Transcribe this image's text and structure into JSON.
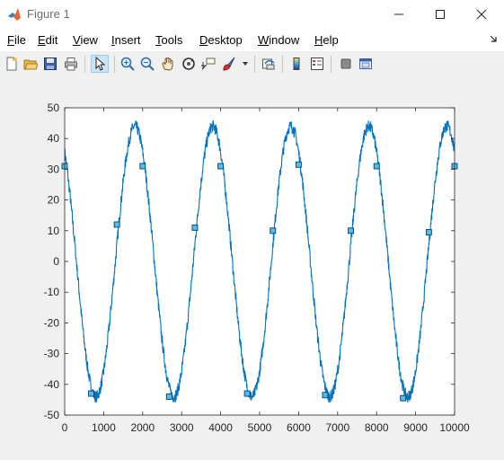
{
  "window": {
    "title": "Figure 1",
    "controls": [
      "minimize",
      "maximize",
      "close"
    ]
  },
  "menu": {
    "items": [
      {
        "label": "File",
        "accel": "F",
        "rest": "ile"
      },
      {
        "label": "Edit",
        "accel": "E",
        "rest": "dit"
      },
      {
        "label": "View",
        "accel": "V",
        "rest": "iew"
      },
      {
        "label": "Insert",
        "accel": "I",
        "rest": "nsert"
      },
      {
        "label": "Tools",
        "accel": "T",
        "rest": "ools"
      },
      {
        "label": "Desktop",
        "accel": "D",
        "rest": "esktop"
      },
      {
        "label": "Window",
        "accel": "W",
        "rest": "indow"
      },
      {
        "label": "Help",
        "accel": "H",
        "rest": "elp"
      }
    ]
  },
  "toolbar": {
    "buttons": [
      "new-figure-icon",
      "open-file-icon",
      "save-icon",
      "print-icon",
      "edit-plot-icon",
      "zoom-in-icon",
      "zoom-out-icon",
      "pan-icon",
      "rotate-3d-icon",
      "data-cursor-icon",
      "brush-icon",
      "link-plot-icon",
      "colorbar-icon",
      "legend-icon",
      "hide-plot-tools-icon",
      "show-plot-tools-icon"
    ]
  },
  "colors": {
    "series": "#0072bd",
    "marker_fill": "#4dbeee",
    "axes": "#262626"
  },
  "chart_data": {
    "type": "line",
    "xlim": [
      0,
      10000
    ],
    "ylim": [
      -50,
      50
    ],
    "xticks": [
      0,
      1000,
      2000,
      3000,
      4000,
      5000,
      6000,
      7000,
      8000,
      9000,
      10000
    ],
    "yticks": [
      -50,
      -40,
      -30,
      -20,
      -10,
      0,
      10,
      20,
      30,
      40,
      50
    ],
    "grid": false,
    "series": [
      {
        "style": "noisy sinusoid",
        "amplitude": 44,
        "period": 2000,
        "peak_x": 1800,
        "noise_band": 2,
        "x_range": [
          0,
          10000
        ]
      }
    ],
    "markers": [
      {
        "x": 0,
        "y": 31
      },
      {
        "x": 680,
        "y": -43
      },
      {
        "x": 1340,
        "y": 12
      },
      {
        "x": 2000,
        "y": 31
      },
      {
        "x": 2680,
        "y": -44
      },
      {
        "x": 3340,
        "y": 11
      },
      {
        "x": 4000,
        "y": 31
      },
      {
        "x": 4680,
        "y": -43
      },
      {
        "x": 5340,
        "y": 10
      },
      {
        "x": 6000,
        "y": 31.5
      },
      {
        "x": 6680,
        "y": -43.5
      },
      {
        "x": 7340,
        "y": 10
      },
      {
        "x": 8000,
        "y": 31
      },
      {
        "x": 8680,
        "y": -44.5
      },
      {
        "x": 9340,
        "y": 9.5
      },
      {
        "x": 10000,
        "y": 31
      }
    ]
  }
}
